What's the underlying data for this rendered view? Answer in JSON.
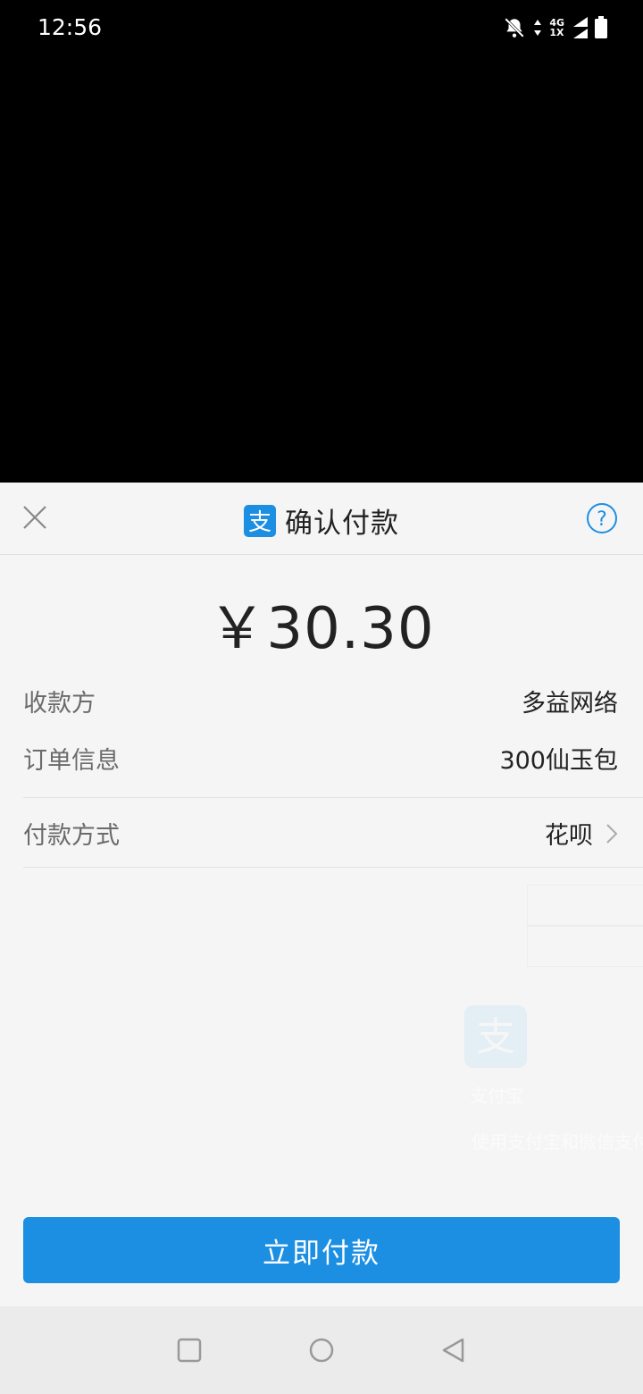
{
  "status_bar": {
    "time": "12:56",
    "network_top": "4G",
    "network_bottom": "1X",
    "icons": [
      "bell-muted-icon",
      "data-arrows-icon",
      "signal-icon",
      "signal-icon",
      "battery-icon"
    ]
  },
  "sheet": {
    "title": "确认付款",
    "logo": "alipay-logo",
    "close_icon": "close-icon",
    "help_icon": "help-icon",
    "amount": "￥30.30",
    "rows": [
      {
        "label": "收款方",
        "value": "多益网络"
      },
      {
        "label": "订单信息",
        "value": "300仙玉包"
      },
      {
        "label": "付款方式",
        "value": "花呗"
      }
    ],
    "pay_button": "立即付款",
    "background_faded_text": [
      "支付宝",
      "使用支付宝和微信支付"
    ]
  },
  "nav_bar": {
    "buttons": [
      "recents-icon",
      "home-icon",
      "back-icon"
    ]
  },
  "colors": {
    "accent": "#1c8fe3",
    "sheet_bg": "#f5f5f5",
    "navbar_bg": "#ebebeb"
  }
}
